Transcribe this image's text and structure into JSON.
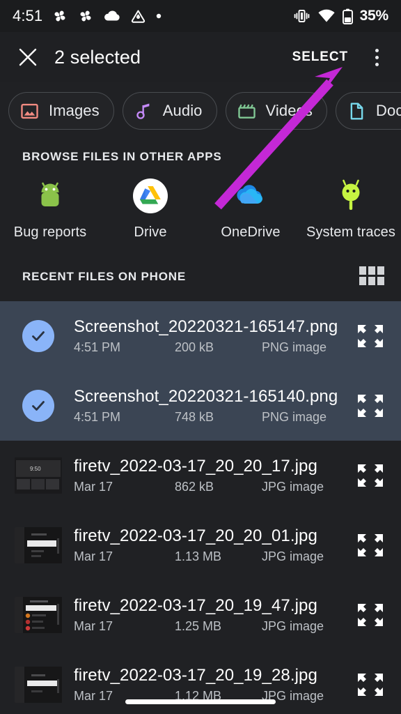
{
  "status_bar": {
    "time": "4:51",
    "battery_percent": "35%",
    "left_icons": [
      "fan-icon",
      "fan-icon",
      "cloud-icon",
      "triangle-drop-icon",
      "dot-icon"
    ],
    "right_icons": [
      "vibrate-icon",
      "wifi-icon",
      "battery-icon"
    ]
  },
  "app_bar": {
    "close_icon": "close-icon",
    "title": "2 selected",
    "select_label": "SELECT",
    "overflow_icon": "overflow-menu-icon"
  },
  "chips": [
    {
      "label": "Images",
      "icon": "image-icon",
      "color": "#f28b82"
    },
    {
      "label": "Audio",
      "icon": "music-note-icon",
      "color": "#c58af9"
    },
    {
      "label": "Videos",
      "icon": "clapperboard-icon",
      "color": "#81c995"
    },
    {
      "label": "Documents",
      "icon": "document-icon",
      "color": "#78d9ec"
    }
  ],
  "browse_section": {
    "title": "BROWSE FILES IN OTHER APPS",
    "apps": [
      {
        "label": "Bug reports",
        "icon": "android-bug-icon"
      },
      {
        "label": "Drive",
        "icon": "google-drive-icon"
      },
      {
        "label": "OneDrive",
        "icon": "onedrive-cloud-icon"
      },
      {
        "label": "System traces",
        "icon": "android-trace-icon"
      }
    ]
  },
  "recent_section": {
    "title": "RECENT FILES ON PHONE",
    "grid_toggle_icon": "grid-view-icon",
    "files": [
      {
        "name": "Screenshot_20220321-165147.png",
        "date": "4:51 PM",
        "size": "200 kB",
        "type": "PNG image",
        "selected": true,
        "lead_icon": "check-circle-icon",
        "action_icon": "expand-icon"
      },
      {
        "name": "Screenshot_20220321-165140.png",
        "date": "4:51 PM",
        "size": "748 kB",
        "type": "PNG image",
        "selected": true,
        "lead_icon": "check-circle-icon",
        "action_icon": "expand-icon"
      },
      {
        "name": "firetv_2022-03-17_20_20_17.jpg",
        "date": "Mar 17",
        "size": "862 kB",
        "type": "JPG image",
        "selected": false,
        "lead_icon": "file-thumbnail",
        "action_icon": "expand-icon"
      },
      {
        "name": "firetv_2022-03-17_20_20_01.jpg",
        "date": "Mar 17",
        "size": "1.13 MB",
        "type": "JPG image",
        "selected": false,
        "lead_icon": "file-thumbnail",
        "action_icon": "expand-icon"
      },
      {
        "name": "firetv_2022-03-17_20_19_47.jpg",
        "date": "Mar 17",
        "size": "1.25 MB",
        "type": "JPG image",
        "selected": false,
        "lead_icon": "file-thumbnail",
        "action_icon": "expand-icon"
      },
      {
        "name": "firetv_2022-03-17_20_19_28.jpg",
        "date": "Mar 17",
        "size": "1.12 MB",
        "type": "JPG image",
        "selected": false,
        "lead_icon": "file-thumbnail",
        "action_icon": "expand-icon"
      }
    ]
  },
  "annotation": {
    "arrow_color": "#c428d6",
    "points_to": "SELECT"
  },
  "theme": {
    "background": "#202124",
    "app_bar_background": "#1f2023",
    "selected_row_background": "#3b4554",
    "accent_check": "#8ab4f8",
    "primary_text": "#ffffff",
    "secondary_text": "#bdc1c6"
  }
}
